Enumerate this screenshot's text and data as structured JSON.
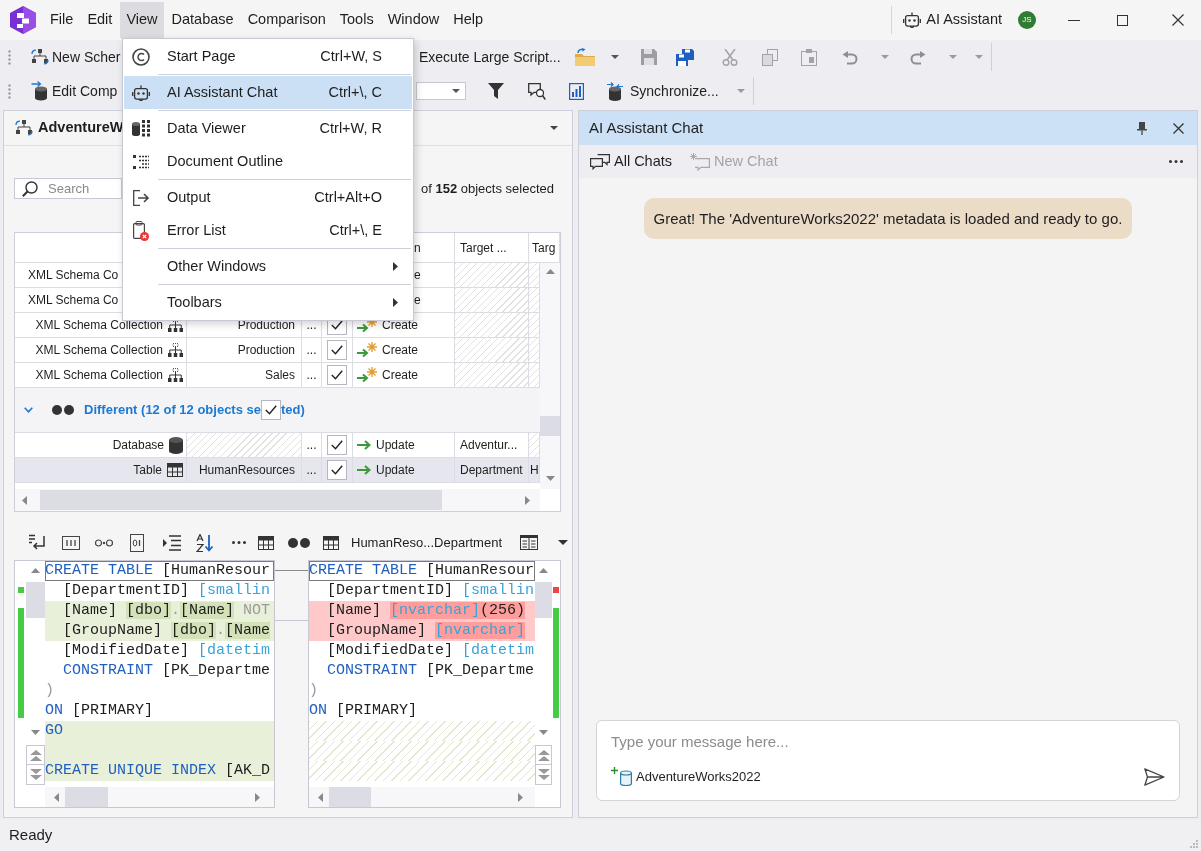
{
  "title_bar": {
    "menu": [
      {
        "label": "File",
        "selected": false
      },
      {
        "label": "Edit",
        "selected": false
      },
      {
        "label": "View",
        "selected": true
      },
      {
        "label": "Database",
        "selected": false
      },
      {
        "label": "Comparison",
        "selected": false
      },
      {
        "label": "Tools",
        "selected": false
      },
      {
        "label": "Window",
        "selected": false
      },
      {
        "label": "Help",
        "selected": false
      }
    ],
    "assistant_button": "AI Assistant",
    "avatar_initials": "JS"
  },
  "toolbar_1": {
    "new_comparison": "New Scher",
    "execute_script": "Execute Large Script..."
  },
  "toolbar_2": {
    "edit_comparison": "Edit Comp",
    "synchronize": "Synchronize..."
  },
  "view_menu": {
    "items": [
      {
        "kind": "command",
        "label": "Start Page",
        "shortcut": "Ctrl+W, S",
        "separator_before": false,
        "selected": false
      },
      {
        "kind": "command",
        "label": "AI Assistant Chat",
        "shortcut": "Ctrl+\\, C",
        "separator_before": true,
        "selected": true
      },
      {
        "kind": "command",
        "label": "Data Viewer",
        "shortcut": "Ctrl+W, R",
        "separator_before": true,
        "selected": false
      },
      {
        "kind": "command",
        "label": "Document Outline",
        "separator_before": false,
        "selected": false
      },
      {
        "kind": "command",
        "label": "Output",
        "shortcut": "Ctrl+Alt+O",
        "separator_before": true,
        "selected": false
      },
      {
        "kind": "command",
        "label": "Error List",
        "shortcut": "Ctrl+\\, E",
        "separator_before": false,
        "selected": false
      },
      {
        "kind": "submenu",
        "label": "Other Windows",
        "separator_before": true,
        "selected": false
      },
      {
        "kind": "submenu",
        "label": "Toolbars",
        "separator_before": true,
        "selected": false
      }
    ]
  },
  "comparison_document": {
    "title": "AdventureW",
    "search": {
      "placeholder": "Search"
    },
    "selection_summary": "of **152** objects selected",
    "grid": {
      "header": {
        "column_5": "n",
        "column_6": "Target ...",
        "column_7": "Targ"
      },
      "rows": [
        {
          "kind": "covered",
          "type": "XML Schema Co",
          "operation": {
            "label": "e"
          },
          "selected": false
        },
        {
          "kind": "covered",
          "type": "XML Schema Co",
          "operation": {
            "label": "e"
          },
          "selected": false
        },
        {
          "kind": "xml_schema",
          "type": "XML Schema Collection",
          "schema": "Production",
          "details": "...",
          "checked": true,
          "operation": {
            "kind": "create",
            "label": "Create"
          },
          "selected": false
        },
        {
          "kind": "xml_schema",
          "type": "XML Schema Collection",
          "schema": "Production",
          "details": "...",
          "checked": true,
          "operation": {
            "kind": "create",
            "label": "Create"
          },
          "selected": false
        },
        {
          "kind": "xml_schema",
          "type": "XML Schema Collection",
          "schema": "Sales",
          "details": "...",
          "checked": true,
          "operation": {
            "kind": "create",
            "label": "Create"
          },
          "selected": false
        },
        {
          "kind": "group",
          "label_start": "Different (12 of 12 objects se",
          "label_end": "ted)",
          "expanded": true,
          "checked": true,
          "selected": false
        },
        {
          "kind": "database",
          "type": "Database",
          "details": "...",
          "checked": true,
          "operation": {
            "kind": "update",
            "label": "Update"
          },
          "target": "Adventur...",
          "selected": false
        },
        {
          "kind": "table",
          "type": "Table",
          "schema": "HumanResources",
          "details": "...",
          "checked": true,
          "operation": {
            "kind": "update",
            "label": "Update"
          },
          "target": "Department",
          "column_7": "H",
          "selected": true
        }
      ]
    }
  },
  "diff_view": {
    "toolbar": {
      "object_label": "HumanReso...Department"
    },
    "panes": [
      {
        "kind": "source",
        "markers": [
          {
            "kind": "dot",
            "color": "#44cc44"
          },
          {
            "kind": "bar",
            "color": "#44cc44"
          }
        ],
        "lines": [
          {
            "kind": "code",
            "current": true,
            "changed": false,
            "tokens": [
              {
                "text": "CREATE TABLE",
                "kind": "keyword",
                "changed": false
              },
              {
                "text": " [HumanResour",
                "kind": "plain",
                "changed": false
              }
            ]
          },
          {
            "kind": "code",
            "current": false,
            "changed": false,
            "tokens": [
              {
                "text": "  [DepartmentID] ",
                "kind": "plain",
                "changed": false
              },
              {
                "text": "[smallin",
                "kind": "type",
                "changed": false
              }
            ]
          },
          {
            "kind": "code",
            "current": false,
            "changed": true,
            "tokens": [
              {
                "text": "  [Name] ",
                "kind": "plain",
                "changed": false
              },
              {
                "text": "[dbo]",
                "kind": "plain",
                "changed": true
              },
              {
                "text": ".",
                "kind": "dim",
                "changed": false
              },
              {
                "text": "[Name]",
                "kind": "plain",
                "changed": true
              },
              {
                "text": " NOT",
                "kind": "dim",
                "changed": false
              }
            ]
          },
          {
            "kind": "code",
            "current": false,
            "changed": true,
            "tokens": [
              {
                "text": "  [GroupName] ",
                "kind": "plain",
                "changed": false
              },
              {
                "text": "[dbo]",
                "kind": "plain",
                "changed": true
              },
              {
                "text": ".",
                "kind": "dim",
                "changed": false
              },
              {
                "text": "[Name",
                "kind": "plain",
                "changed": true
              }
            ]
          },
          {
            "kind": "code",
            "current": false,
            "changed": false,
            "tokens": [
              {
                "text": "  [ModifiedDate] ",
                "kind": "plain",
                "changed": false
              },
              {
                "text": "[datetim",
                "kind": "type",
                "changed": false
              }
            ]
          },
          {
            "kind": "code",
            "current": false,
            "changed": false,
            "tokens": [
              {
                "text": "  CONSTRAINT",
                "kind": "keyword",
                "changed": false
              },
              {
                "text": " [PK_Departme",
                "kind": "plain",
                "changed": false
              }
            ]
          },
          {
            "kind": "code",
            "current": false,
            "changed": false,
            "tokens": [
              {
                "text": ")",
                "kind": "dim",
                "changed": false
              }
            ]
          },
          {
            "kind": "code",
            "current": false,
            "changed": false,
            "tokens": [
              {
                "text": "ON",
                "kind": "keyword",
                "changed": false
              },
              {
                "text": " [PRIMARY]",
                "kind": "plain",
                "changed": false
              }
            ]
          },
          {
            "kind": "code",
            "current": false,
            "changed": true,
            "tokens": [
              {
                "text": "GO",
                "kind": "keyword",
                "changed": false
              }
            ]
          },
          {
            "kind": "code",
            "current": false,
            "changed": true
          },
          {
            "kind": "code",
            "current": false,
            "changed": true,
            "tokens": [
              {
                "text": "CREATE UNIQUE INDEX",
                "kind": "keyword",
                "changed": false
              },
              {
                "text": " [AK_D",
                "kind": "plain",
                "changed": false
              }
            ]
          }
        ]
      },
      {
        "kind": "target",
        "markers": [
          {
            "kind": "dot",
            "color": "#ee4444"
          },
          {
            "kind": "bar",
            "color": "#44cc44"
          }
        ],
        "lines": [
          {
            "kind": "code",
            "current": true,
            "changed": false,
            "tokens": [
              {
                "text": "CREATE TABLE",
                "kind": "keyword",
                "changed": false
              },
              {
                "text": " [HumanResour",
                "kind": "plain",
                "changed": false
              }
            ]
          },
          {
            "kind": "code",
            "current": false,
            "changed": false,
            "tokens": [
              {
                "text": "  [DepartmentID] ",
                "kind": "plain",
                "changed": false
              },
              {
                "text": "[smallin",
                "kind": "type",
                "changed": false
              }
            ]
          },
          {
            "kind": "code",
            "current": false,
            "changed": true,
            "tokens": [
              {
                "text": "  [Name] ",
                "kind": "plain",
                "changed": false
              },
              {
                "text": "[nvarchar]",
                "kind": "type",
                "changed": true
              },
              {
                "text": "(256)",
                "kind": "plain",
                "changed": true
              }
            ]
          },
          {
            "kind": "code",
            "current": false,
            "changed": true,
            "tokens": [
              {
                "text": "  [GroupName] ",
                "kind": "plain",
                "changed": false
              },
              {
                "text": "[nvarchar]",
                "kind": "type",
                "changed": true
              }
            ]
          },
          {
            "kind": "code",
            "current": false,
            "changed": false,
            "tokens": [
              {
                "text": "  [ModifiedDate] ",
                "kind": "plain",
                "changed": false
              },
              {
                "text": "[datetim",
                "kind": "type",
                "changed": false
              }
            ]
          },
          {
            "kind": "code",
            "current": false,
            "changed": false,
            "tokens": [
              {
                "text": "  CONSTRAINT",
                "kind": "keyword",
                "changed": false
              },
              {
                "text": " [PK_Departme",
                "kind": "plain",
                "changed": false
              }
            ]
          },
          {
            "kind": "code",
            "current": false,
            "changed": false,
            "tokens": [
              {
                "text": ")",
                "kind": "dim",
                "changed": false
              }
            ]
          },
          {
            "kind": "code",
            "current": false,
            "changed": false,
            "tokens": [
              {
                "text": "ON",
                "kind": "keyword",
                "changed": false
              },
              {
                "text": " [PRIMARY]",
                "kind": "plain",
                "changed": false
              }
            ]
          },
          {
            "kind": "gap"
          },
          {
            "kind": "gap"
          },
          {
            "kind": "gap"
          }
        ]
      }
    ]
  },
  "chat_panel": {
    "title": "AI Assistant Chat",
    "toolbar": [
      {
        "label": "All Chats",
        "disabled": false
      },
      {
        "label": "New Chat",
        "disabled": true
      }
    ],
    "messages": [
      {
        "kind": "assistant",
        "text": "Great! The 'AdventureWorks2022' metadata is loaded and ready to go."
      }
    ],
    "composer": {
      "placeholder": "Type your message here...",
      "context": "AdventureWorks2022"
    }
  },
  "status_bar": {
    "text": "Ready"
  }
}
